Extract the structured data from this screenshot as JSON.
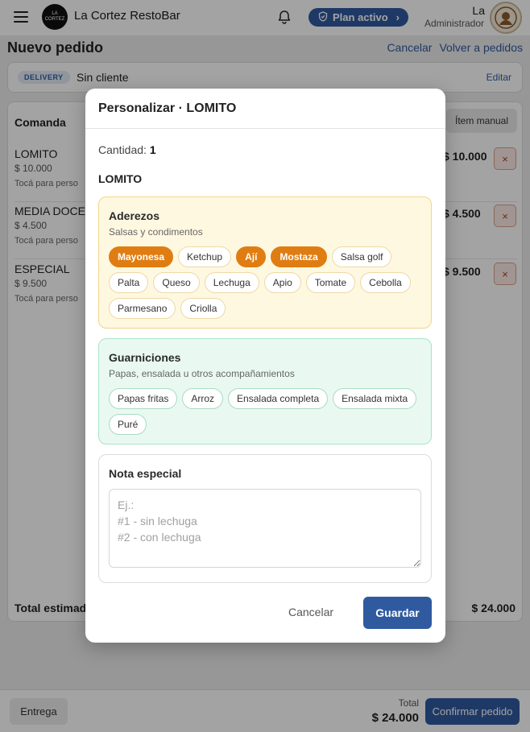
{
  "app": {
    "brand": "La Cortez RestoBar",
    "logo_text": "LA CORTEZ",
    "plan_label": "Plan activo",
    "user_name": "La",
    "user_role": "Administrador"
  },
  "page": {
    "title": "Nuevo pedido",
    "cancel_link": "Cancelar",
    "back_link": "Volver a pedidos"
  },
  "client": {
    "badge": "DELIVERY",
    "name": "Sin cliente",
    "edit": "Editar"
  },
  "order": {
    "heading": "Comanda",
    "manual_button": "Ítem manual",
    "items": [
      {
        "name": "LOMITO",
        "price": "$ 10.000",
        "hint": "Tocá para perso",
        "total": "$ 10.000",
        "remove": "×"
      },
      {
        "name": "MEDIA DOCEN",
        "price": "$ 4.500",
        "hint": "Tocá para perso",
        "total": "$ 4.500",
        "remove": "×"
      },
      {
        "name": "ESPECIAL",
        "price": "$ 9.500",
        "hint": "Tocá para perso",
        "total": "$ 9.500",
        "remove": "×"
      }
    ],
    "estimate_label": "Total estimad",
    "estimate_value": "$ 24.000"
  },
  "footer": {
    "delivery_button": "Entrega",
    "total_label": "Total",
    "total_value": "$ 24.000",
    "confirm_button": "Confirmar pedido"
  },
  "modal": {
    "title": "Personalizar · LOMITO",
    "quantity_label": "Cantidad:",
    "quantity_value": "1",
    "product_name": "LOMITO",
    "aderezos": {
      "title": "Aderezos",
      "subtitle": "Salsas y condimentos",
      "options": [
        {
          "label": "Mayonesa",
          "selected": true
        },
        {
          "label": "Ketchup",
          "selected": false
        },
        {
          "label": "Ají",
          "selected": true
        },
        {
          "label": "Mostaza",
          "selected": true
        },
        {
          "label": "Salsa golf",
          "selected": false
        },
        {
          "label": "Palta",
          "selected": false
        },
        {
          "label": "Queso",
          "selected": false
        },
        {
          "label": "Lechuga",
          "selected": false
        },
        {
          "label": "Apio",
          "selected": false
        },
        {
          "label": "Tomate",
          "selected": false
        },
        {
          "label": "Cebolla",
          "selected": false
        },
        {
          "label": "Parmesano",
          "selected": false
        },
        {
          "label": "Criolla",
          "selected": false
        }
      ]
    },
    "guarniciones": {
      "title": "Guarniciones",
      "subtitle": "Papas, ensalada u otros acompañamientos",
      "options": [
        {
          "label": "Papas fritas",
          "selected": false
        },
        {
          "label": "Arroz",
          "selected": false
        },
        {
          "label": "Ensalada completa",
          "selected": false
        },
        {
          "label": "Ensalada mixta",
          "selected": false
        },
        {
          "label": "Puré",
          "selected": false
        }
      ]
    },
    "nota": {
      "title": "Nota especial",
      "placeholder": "Ej.:\n#1 - sin lechuga\n#2 - con lechuga",
      "value": ""
    },
    "cancel_button": "Cancelar",
    "save_button": "Guardar"
  },
  "colors": {
    "primary": "#2f5aa0",
    "selected_chip": "#e07d12",
    "aderezos_bg": "#fff8e1",
    "guarniciones_bg": "#e9f9f1"
  }
}
